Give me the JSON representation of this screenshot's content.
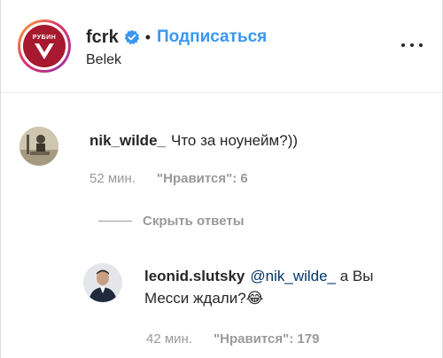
{
  "header": {
    "logo_text": "РУБИН",
    "username": "fcrk",
    "separator": "•",
    "follow_label": "Подписаться",
    "location": "Belek"
  },
  "comments": [
    {
      "username": "nik_wilde_",
      "text": "Что за ноунейм?))",
      "time": "52 мин.",
      "likes": "\"Нравится\": 6"
    }
  ],
  "hide_replies_label": "Скрыть ответы",
  "replies": [
    {
      "username": "leonid.slutsky",
      "mention": "@nik_wilde_",
      "text_line1": " а Вы",
      "text_line2": "Месси ждали?",
      "emoji": "😂",
      "time": "42 мин.",
      "likes": "\"Нравится\": 179"
    }
  ],
  "colors": {
    "accent": "#3897f0",
    "verified": "#3897f0",
    "muted": "#999999",
    "brand_red": "#a6192e"
  },
  "icons": {
    "verified": "verified-badge-icon",
    "more": "more-horizontal-icon"
  }
}
